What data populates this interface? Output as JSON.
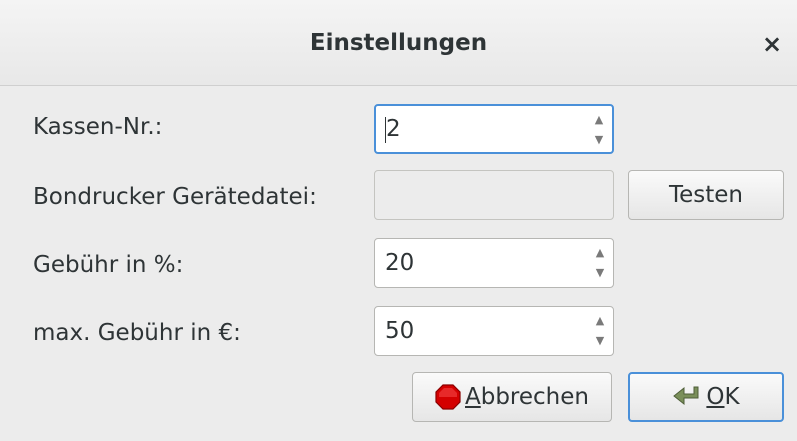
{
  "window": {
    "title": "Einstellungen",
    "close_glyph": "×"
  },
  "form": {
    "kassen_nr": {
      "label": "Kassen-Nr.:",
      "value": "2"
    },
    "bondrucker": {
      "label": "Bondrucker Gerätedatei:",
      "value": "",
      "test_button": "Testen"
    },
    "gebuehr": {
      "label": "Gebühr in %:",
      "value": "20"
    },
    "max_gebuehr": {
      "label": "max. Gebühr in €:",
      "value": "50"
    }
  },
  "buttons": {
    "cancel": {
      "mnemonic": "A",
      "rest": "bbrechen",
      "icon": "stop-icon"
    },
    "ok": {
      "mnemonic": "O",
      "rest": "K",
      "icon": "ok-arrow-icon"
    }
  },
  "spin_glyphs": {
    "up": "▲",
    "down": "▼"
  }
}
